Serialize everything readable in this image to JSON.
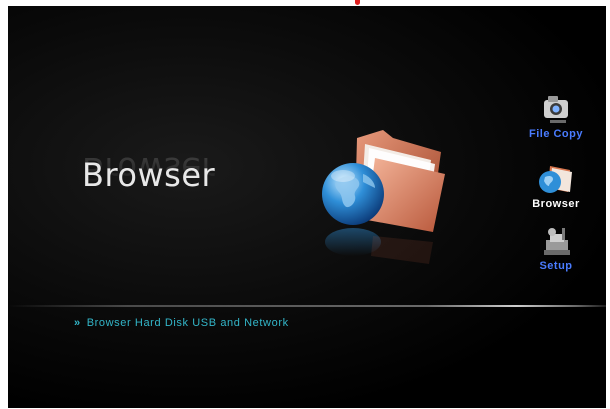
{
  "screen": {
    "title": "Browser",
    "description_bullet": "»",
    "description": "Browser Hard Disk USB and Network"
  },
  "side_menu": {
    "items": [
      {
        "label": "File Copy",
        "icon": "camera-copy-icon",
        "active": false
      },
      {
        "label": "Browser",
        "icon": "globe-folder-icon",
        "active": true
      },
      {
        "label": "Setup",
        "icon": "gear-tools-icon",
        "active": false
      }
    ]
  },
  "colors": {
    "background": "#000000",
    "menu_label": "#4a7cff",
    "menu_label_active": "#ffffff",
    "description_text": "#33b6c9",
    "title_text": "#e8e8e8"
  },
  "icons": {
    "hero": "globe-folder-icon"
  }
}
